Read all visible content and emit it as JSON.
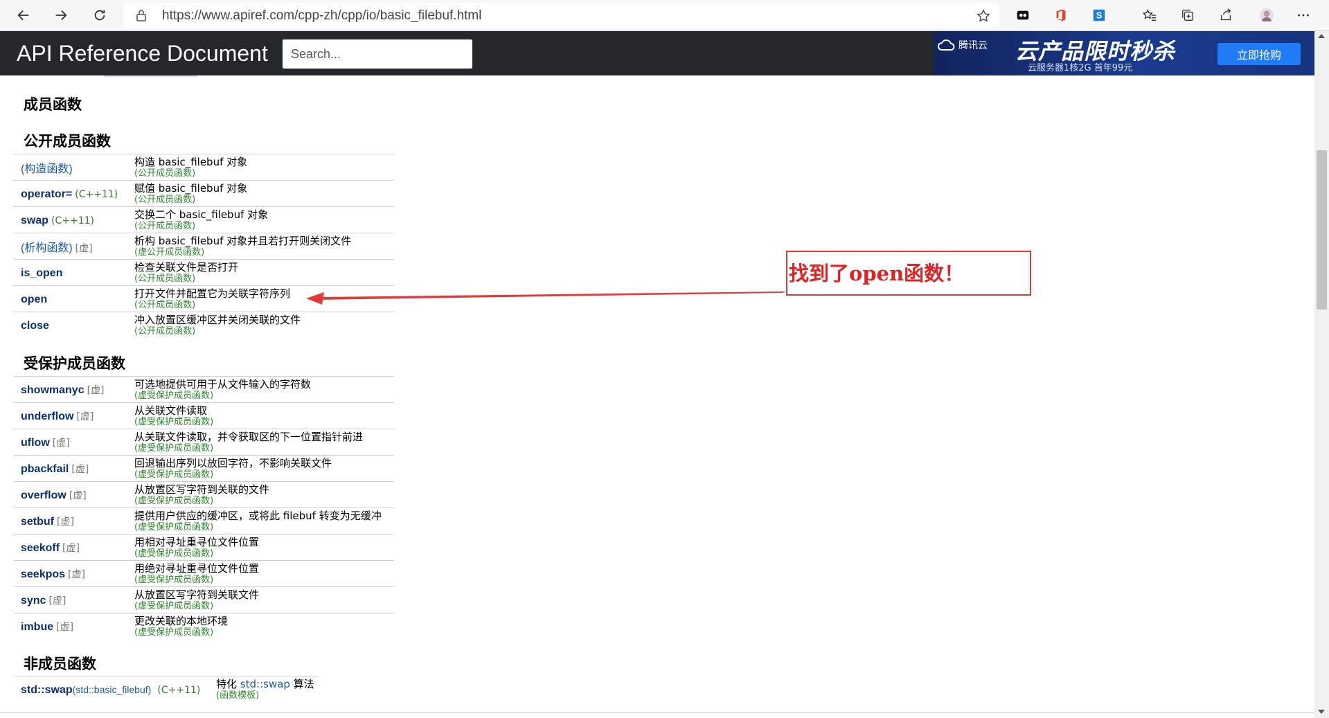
{
  "browser": {
    "url": "https://www.apiref.com/cpp-zh/cpp/io/basic_filebuf.html",
    "icons": [
      "back-icon",
      "forward-icon",
      "refresh-icon",
      "lock-icon",
      "star-icon",
      "extension-icon",
      "office-icon",
      "s-extension-icon",
      "favorites-icon",
      "collections-icon",
      "share-icon",
      "avatar",
      "more-icon"
    ]
  },
  "header": {
    "title": "API Reference Document",
    "search_placeholder": "Search..."
  },
  "ad": {
    "brand": "腾讯云",
    "headline": "云产品限时秒杀",
    "sub": "云服务器1核2G  首年99元",
    "cta": "立即抢购"
  },
  "sections": {
    "member_functions": "成员函数",
    "public_member_functions": "公开成员函数",
    "protected_member_functions": "受保护成员函数",
    "non_member_functions": "非成员函数"
  },
  "public_rows": [
    {
      "name": "(构造函数)",
      "qual": "",
      "desc": "构造 basic_filebuf 对象",
      "kind": "(公开成员函数)"
    },
    {
      "name": "operator=",
      "qual": "(C++11)",
      "desc": "赋值 basic_filebuf 对象",
      "kind": "(公开成员函数)"
    },
    {
      "name": "swap",
      "qual": "(C++11)",
      "desc": "交换二个 basic_filebuf 对象",
      "kind": "(公开成员函数)"
    },
    {
      "name": "(析构函数)",
      "qual": "[虚]",
      "desc": "析构 basic_filebuf 对象并且若打开则关闭文件",
      "kind": "(虚公开成员函数)"
    },
    {
      "name": "is_open",
      "qual": "",
      "desc": "检查关联文件是否打开",
      "kind": "(公开成员函数)"
    },
    {
      "name": "open",
      "qual": "",
      "desc": "打开文件并配置它为关联字符序列",
      "kind": "(公开成员函数)"
    },
    {
      "name": "close",
      "qual": "",
      "desc": "冲入放置区缓冲区并关闭关联的文件",
      "kind": "(公开成员函数)"
    }
  ],
  "protected_rows": [
    {
      "name": "showmanyc",
      "qual": "[虚]",
      "desc": "可选地提供可用于从文件输入的字符数",
      "kind": "(虚受保护成员函数)"
    },
    {
      "name": "underflow",
      "qual": "[虚]",
      "desc": "从关联文件读取",
      "kind": "(虚受保护成员函数)"
    },
    {
      "name": "uflow",
      "qual": "[虚]",
      "desc": "从关联文件读取，并令获取区的下一位置指针前进",
      "kind": "(虚受保护成员函数)"
    },
    {
      "name": "pbackfail",
      "qual": "[虚]",
      "desc": "回退输出序列以放回字符，不影响关联文件",
      "kind": "(虚受保护成员函数)"
    },
    {
      "name": "overflow",
      "qual": "[虚]",
      "desc": "从放置区写字符到关联的文件",
      "kind": "(虚受保护成员函数)"
    },
    {
      "name": "setbuf",
      "qual": "[虚]",
      "desc": "提供用户供应的缓冲区，或将此 filebuf 转变为无缓冲",
      "kind": "(虚受保护成员函数)"
    },
    {
      "name": "seekoff",
      "qual": "[虚]",
      "desc": "用相对寻址重寻位文件位置",
      "kind": "(虚受保护成员函数)"
    },
    {
      "name": "seekpos",
      "qual": "[虚]",
      "desc": "用绝对寻址重寻位文件位置",
      "kind": "(虚受保护成员函数)"
    },
    {
      "name": "sync",
      "qual": "[虚]",
      "desc": "从放置区写字符到关联文件",
      "kind": "(虚受保护成员函数)"
    },
    {
      "name": "imbue",
      "qual": "[虚]",
      "desc": "更改关联的本地环境",
      "kind": "(虚受保护成员函数)"
    }
  ],
  "non_member": {
    "name": "std::swap",
    "arg": "(std::basic_filebuf)",
    "qual": "(C++11)",
    "desc_prefix": "特化 ",
    "desc_link": "std::swap",
    "desc_suffix": " 算法",
    "kind": "(函数模板)"
  },
  "annotation": {
    "text": "找到了open函数！",
    "color": "#e02222"
  },
  "colors": {
    "header_bg": "#25282b",
    "link_bold": "#0b2f6f",
    "kind_green": "#2e8a2e",
    "annotation_red": "#e03a3a"
  }
}
